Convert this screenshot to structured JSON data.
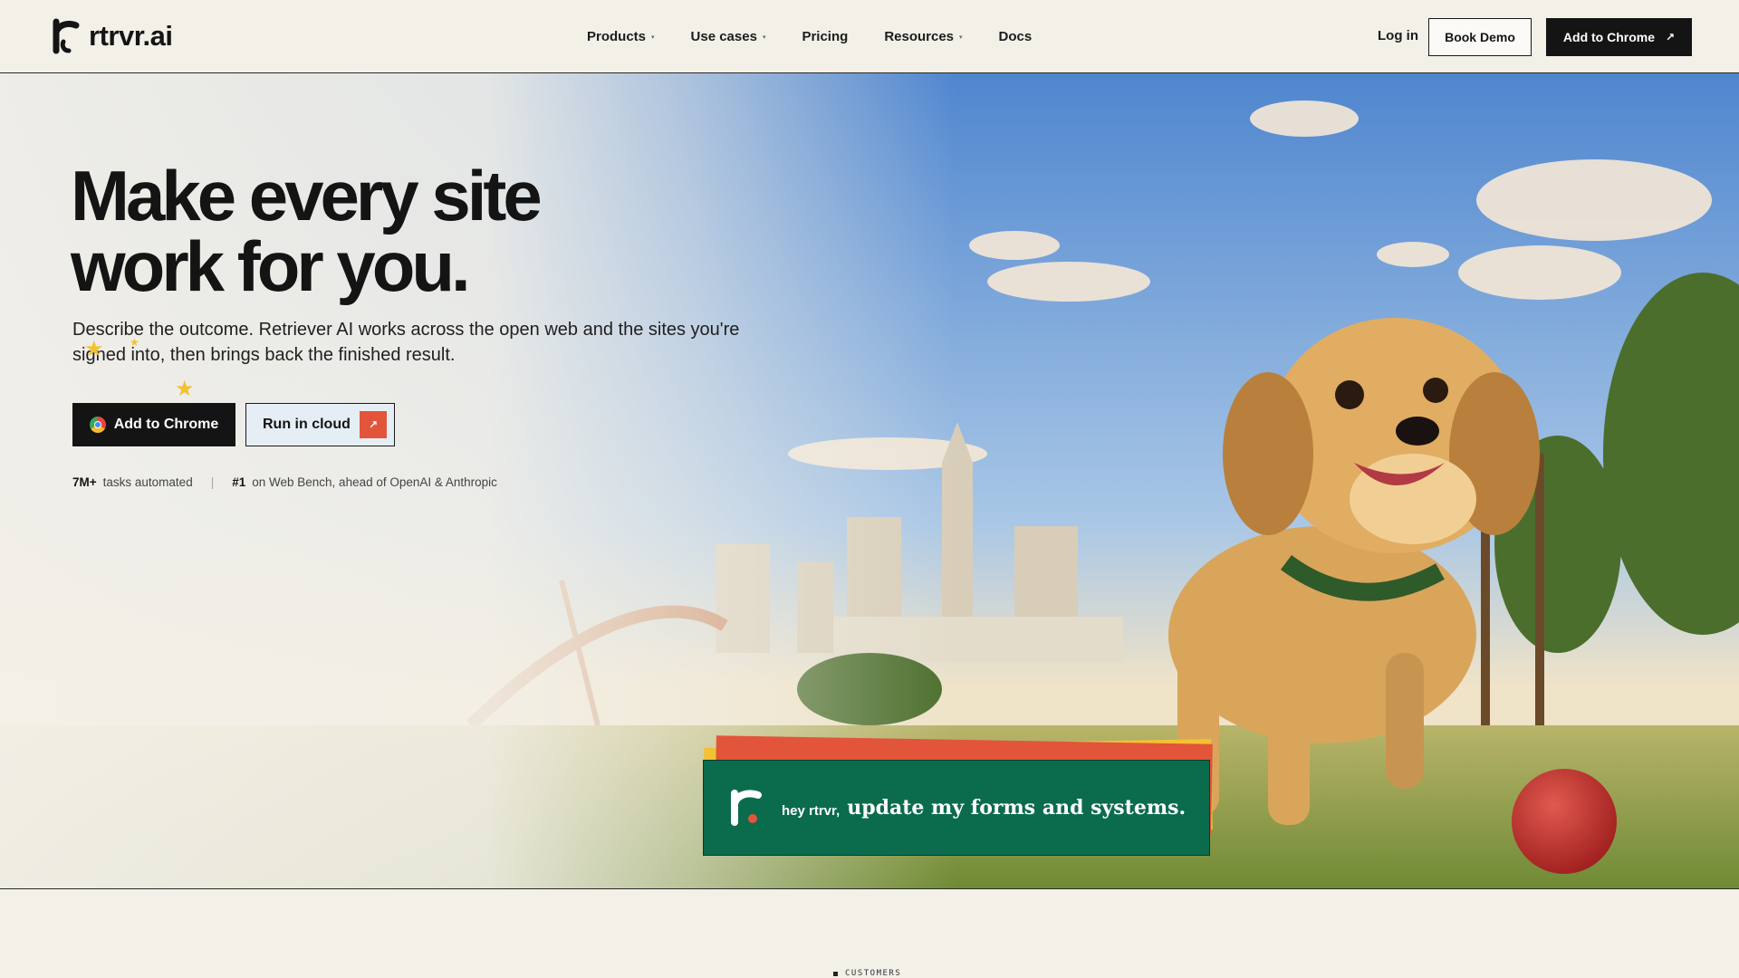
{
  "nav": {
    "brand": "rtrvr.ai",
    "menu": [
      {
        "label": "Products",
        "has_caret": true
      },
      {
        "label": "Use cases",
        "has_caret": true
      },
      {
        "label": "Pricing",
        "has_caret": false
      },
      {
        "label": "Resources",
        "has_caret": true
      },
      {
        "label": "Docs",
        "has_caret": false
      }
    ],
    "login": "Log in",
    "book_demo": "Book Demo",
    "add_to_chrome": "Add to Chrome",
    "caret_glyph": "▾",
    "arrow_glyph": "↗"
  },
  "hero": {
    "headline_line1": "Make every site",
    "headline_line2": "work for you.",
    "subtitle": "Describe the outcome. Retriever AI works across the open web and the sites you're signed into, then brings back the finished result.",
    "cta_primary": "Add to Chrome",
    "cta_secondary": "Run in cloud",
    "stats": [
      {
        "value": "7M+",
        "text": "tasks automated"
      },
      {
        "value": "#1",
        "text": "on Web Bench, ahead of OpenAI & Anthropic"
      }
    ],
    "stat_separator": "|",
    "chat": {
      "prefix": "hey rtrvr,",
      "message": "update my forms and systems."
    }
  },
  "customers_label": "CUSTOMERS",
  "colors": {
    "background": "#f3f0e8",
    "primary": "#141414",
    "accent_orange": "#e2553a",
    "chat_green": "#0b6b4d",
    "yellow": "#f2c233"
  },
  "icons": [
    "rtrvr-logo-icon",
    "chrome-icon",
    "arrow-up-right-icon",
    "caret-down-icon",
    "star-icon"
  ]
}
